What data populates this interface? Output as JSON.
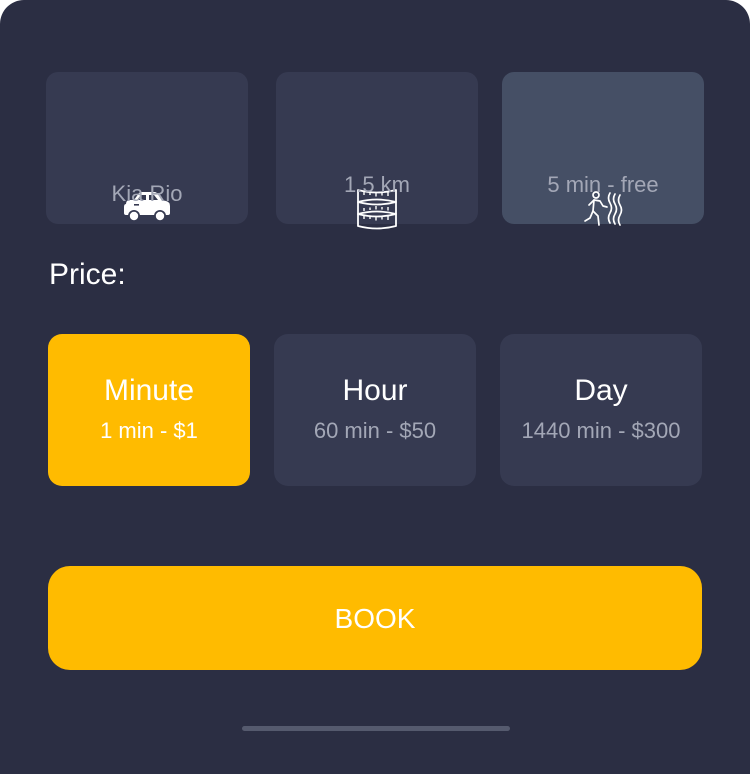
{
  "details": {
    "car": {
      "label": "Kia Rio",
      "icon": "car-icon"
    },
    "distance": {
      "label": "1.5 km",
      "icon": "ruler-icon"
    },
    "walk": {
      "label": "5 min - free",
      "icon": "walking-person-icon"
    }
  },
  "price_heading": "Price:",
  "price_options": [
    {
      "title": "Minute",
      "detail": "1 min - $1",
      "selected": true
    },
    {
      "title": "Hour",
      "detail": "60 min - $50",
      "selected": false
    },
    {
      "title": "Day",
      "detail": "1440 min - $300",
      "selected": false
    }
  ],
  "book_label": "BOOK",
  "colors": {
    "background": "#2b2e43",
    "card": "#363a51",
    "card_active": "#454f65",
    "accent": "#ffbb00",
    "muted_text": "#a3a7b6"
  }
}
